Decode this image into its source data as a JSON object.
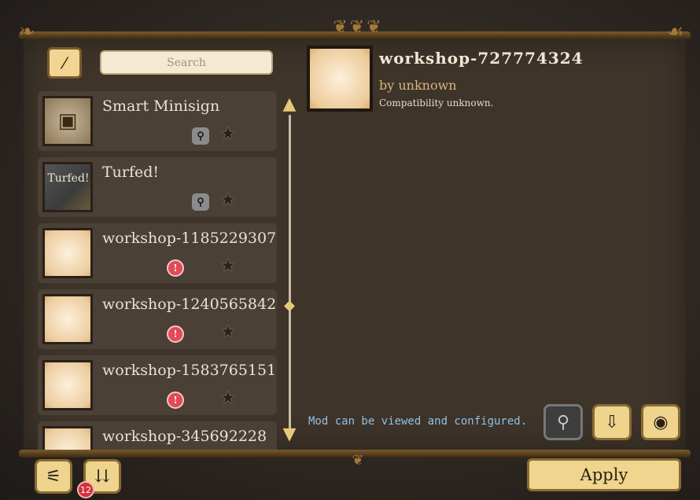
{
  "search": {
    "placeholder": "Search"
  },
  "filter_button": {
    "icon": "filter-toggle-icon",
    "glyph": "⁄"
  },
  "mods": [
    {
      "name": "Smart Minisign",
      "thumb": "chest",
      "status": "server"
    },
    {
      "name": "Turfed!",
      "thumb": "turf",
      "thumb_text": "Turfed!",
      "status": "server"
    },
    {
      "name": "workshop-1185229307",
      "thumb": "blank",
      "status": "warning"
    },
    {
      "name": "workshop-1240565842",
      "thumb": "blank",
      "status": "warning"
    },
    {
      "name": "workshop-1583765151",
      "thumb": "blank",
      "status": "warning"
    },
    {
      "name": "workshop-345692228",
      "thumb": "blank",
      "status": "none"
    }
  ],
  "detail": {
    "title": "workshop-727774324",
    "author": "by unknown",
    "compatibility": "Compatibility unknown.",
    "status_text": "Mod can be viewed and configured."
  },
  "footer": {
    "update_count": "12",
    "apply_label": "Apply"
  },
  "colors": {
    "accent": "#f0d58e",
    "warning": "#e24a55",
    "status_text": "#8fc1e3"
  }
}
